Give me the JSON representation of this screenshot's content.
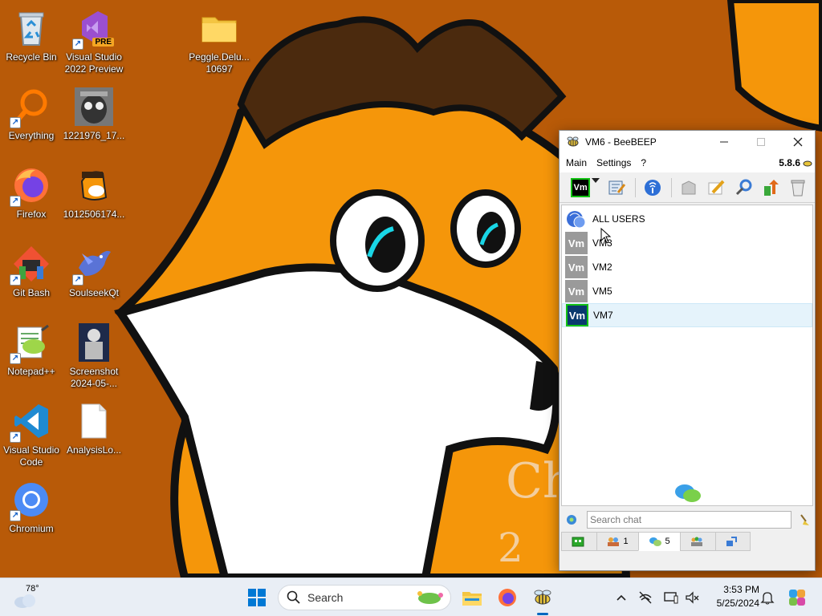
{
  "desktop": {
    "icons": [
      {
        "label": "Recycle Bin"
      },
      {
        "label": "Visual Studio 2022 Preview",
        "badge": "PRE"
      },
      {
        "label": "Peggle.Delu... 10697"
      },
      {
        "label": "Everything"
      },
      {
        "label": "1221976_17..."
      },
      {
        "label": "Firefox"
      },
      {
        "label": "1012506174..."
      },
      {
        "label": "Git Bash"
      },
      {
        "label": "SoulseekQt"
      },
      {
        "label": "Notepad++"
      },
      {
        "label": "Screenshot 2024-05-..."
      },
      {
        "label": "Visual Studio Code"
      },
      {
        "label": "AnalysisLo..."
      },
      {
        "label": "Chromium"
      }
    ]
  },
  "beebeep": {
    "title": "VM6 - BeeBEEP",
    "version": "5.8.6",
    "menu": [
      "Main",
      "Settings",
      "?"
    ],
    "toolbar": {
      "status_badge": "Vm",
      "icons": [
        "status-icon",
        "profile-edit-icon",
        "network-icon",
        "chat-box-icon",
        "pencil-icon",
        "tools-icon",
        "share-icon",
        "trash-icon"
      ]
    },
    "users": [
      {
        "name": "ALL USERS",
        "type": "all"
      },
      {
        "name": "VM3",
        "badge": "Vm",
        "online": false
      },
      {
        "name": "VM2",
        "badge": "Vm",
        "online": false
      },
      {
        "name": "VM5",
        "badge": "Vm",
        "online": false
      },
      {
        "name": "VM7",
        "badge": "Vm",
        "online": true,
        "selected": true
      }
    ],
    "search": {
      "placeholder": "Search chat"
    },
    "tabs": [
      {
        "icon": "home-icon",
        "count": ""
      },
      {
        "icon": "users-icon",
        "count": "1"
      },
      {
        "icon": "chats-icon",
        "count": "5",
        "active": true
      },
      {
        "icon": "groups-icon",
        "count": ""
      },
      {
        "icon": "share-icon",
        "count": ""
      }
    ]
  },
  "taskbar": {
    "weather_temp": "78°",
    "search_label": "Search",
    "time": "3:53 PM",
    "date": "5/25/2024"
  },
  "colors": {
    "wallpaper_orange": "#b85a08",
    "fox_orange": "#f5960a",
    "online_border": "#13c213",
    "badge_offline": "#9a9a9a",
    "badge_online_bg": "#0a3a6e",
    "selected_row": "#e5f3fb"
  }
}
